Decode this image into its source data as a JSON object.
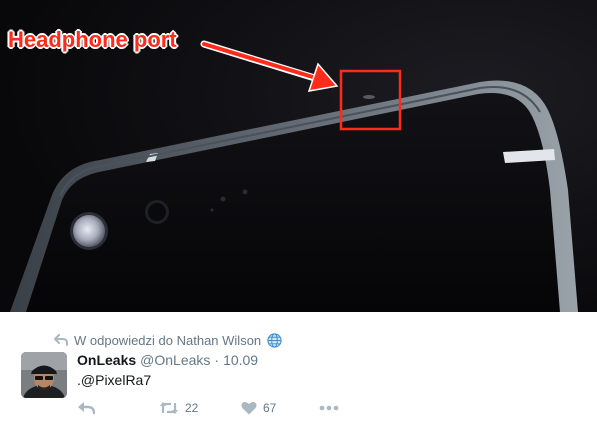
{
  "photo": {
    "annotation": {
      "label": "Headphone port",
      "color": "#ff2b1a"
    }
  },
  "tweet": {
    "reply_context": "W odpowiedzi do Nathan Wilson",
    "author": {
      "name": "OnLeaks",
      "handle": "@OnLeaks",
      "separator": "·",
      "date": "10.09"
    },
    "text": ".@PixelRa7",
    "actions": {
      "reply_icon": "reply-icon",
      "retweet_count": "22",
      "like_count": "67",
      "more_icon": "more-icon"
    }
  }
}
